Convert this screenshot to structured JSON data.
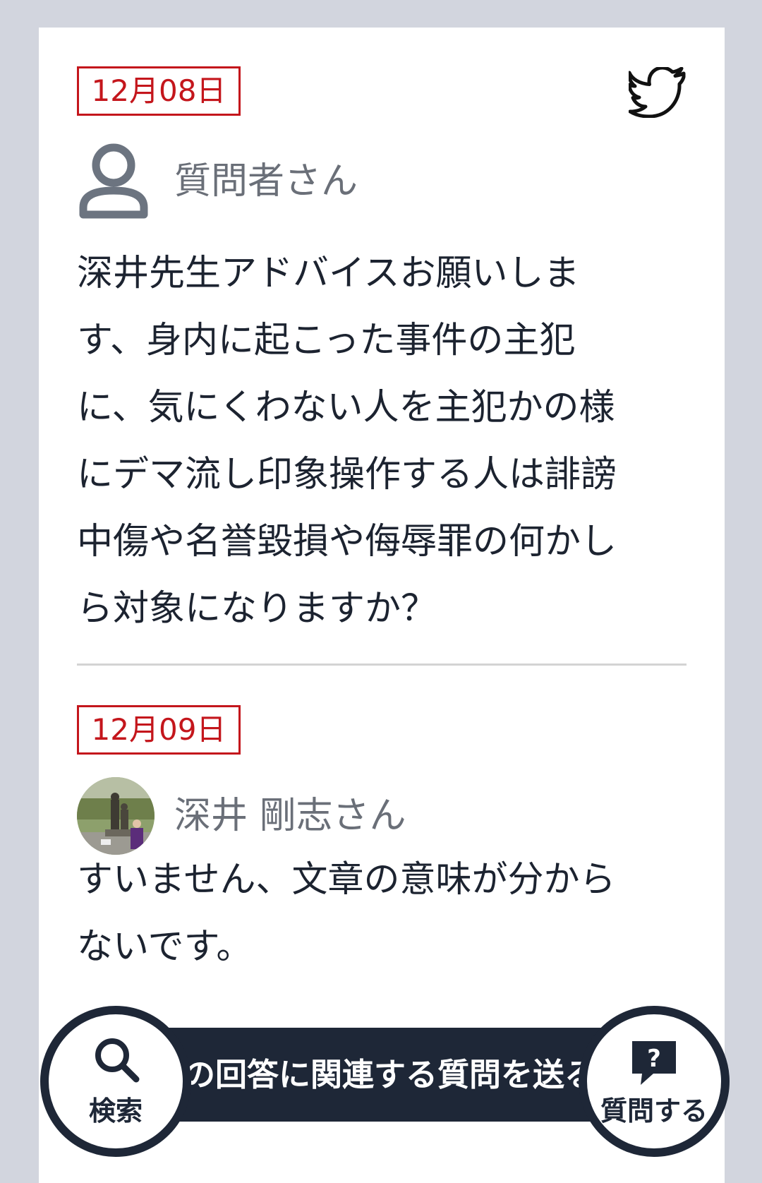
{
  "question": {
    "date": "12月08日",
    "author": "質問者さん",
    "text": "深井先生アドバイスお願いします、身内に起こった事件の主犯に、気にくわない人を主犯かの様にデマ流し印象操作する人は誹謗中傷や名誉毀損や侮辱罪の何かしら対象になりますか？"
  },
  "answer": {
    "date": "12月09日",
    "author": "深井 剛志さん",
    "text": "すいません、文章の意味が分からないです。"
  },
  "bottom_bar": {
    "search_label": "検索",
    "banner_text": "この回答に関連する質問を送る",
    "ask_label": "質問する"
  },
  "colors": {
    "accent_red": "#c4161c",
    "navy": "#1e2737",
    "background": "#d2d5de"
  },
  "icons": [
    "twitter-icon",
    "user-icon",
    "search-icon",
    "question-icon"
  ]
}
